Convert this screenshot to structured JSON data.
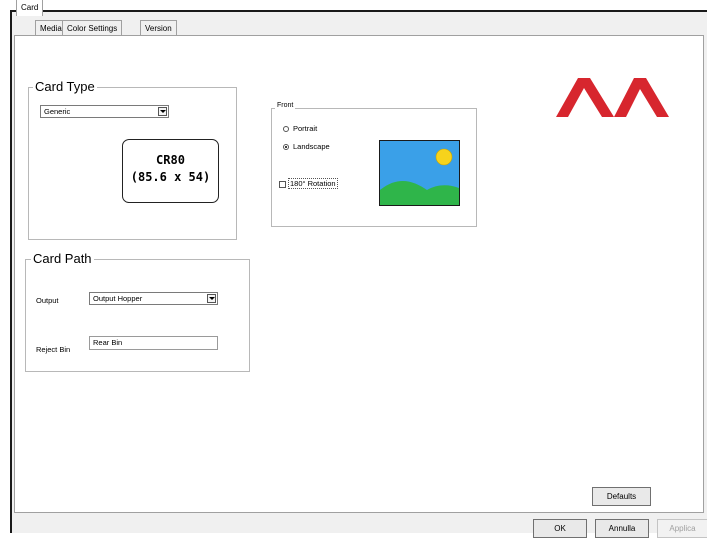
{
  "tabs": [
    "Card",
    "Media",
    "Color Settings",
    "Version"
  ],
  "card_type": {
    "legend": "Card Type",
    "selected": "Generic",
    "preview_line1": "CR80",
    "preview_line2": "(85.6 x 54)"
  },
  "front": {
    "legend": "Front",
    "portrait": "Portrait",
    "landscape": "Landscape",
    "selected": "Landscape",
    "rotation": "180° Rotation",
    "rotation_checked": false
  },
  "card_path": {
    "legend": "Card Path",
    "output_label": "Output",
    "output_value": "Output Hopper",
    "reject_label": "Reject Bin",
    "reject_value": "Rear Bin"
  },
  "buttons": {
    "defaults": "Defaults",
    "ok": "OK",
    "cancel": "Annulla",
    "apply": "Applica"
  },
  "colors": {
    "logo": "#d7262e",
    "sky": "#3aa0e8",
    "hill": "#2fb54a",
    "sun": "#f6d31c"
  }
}
